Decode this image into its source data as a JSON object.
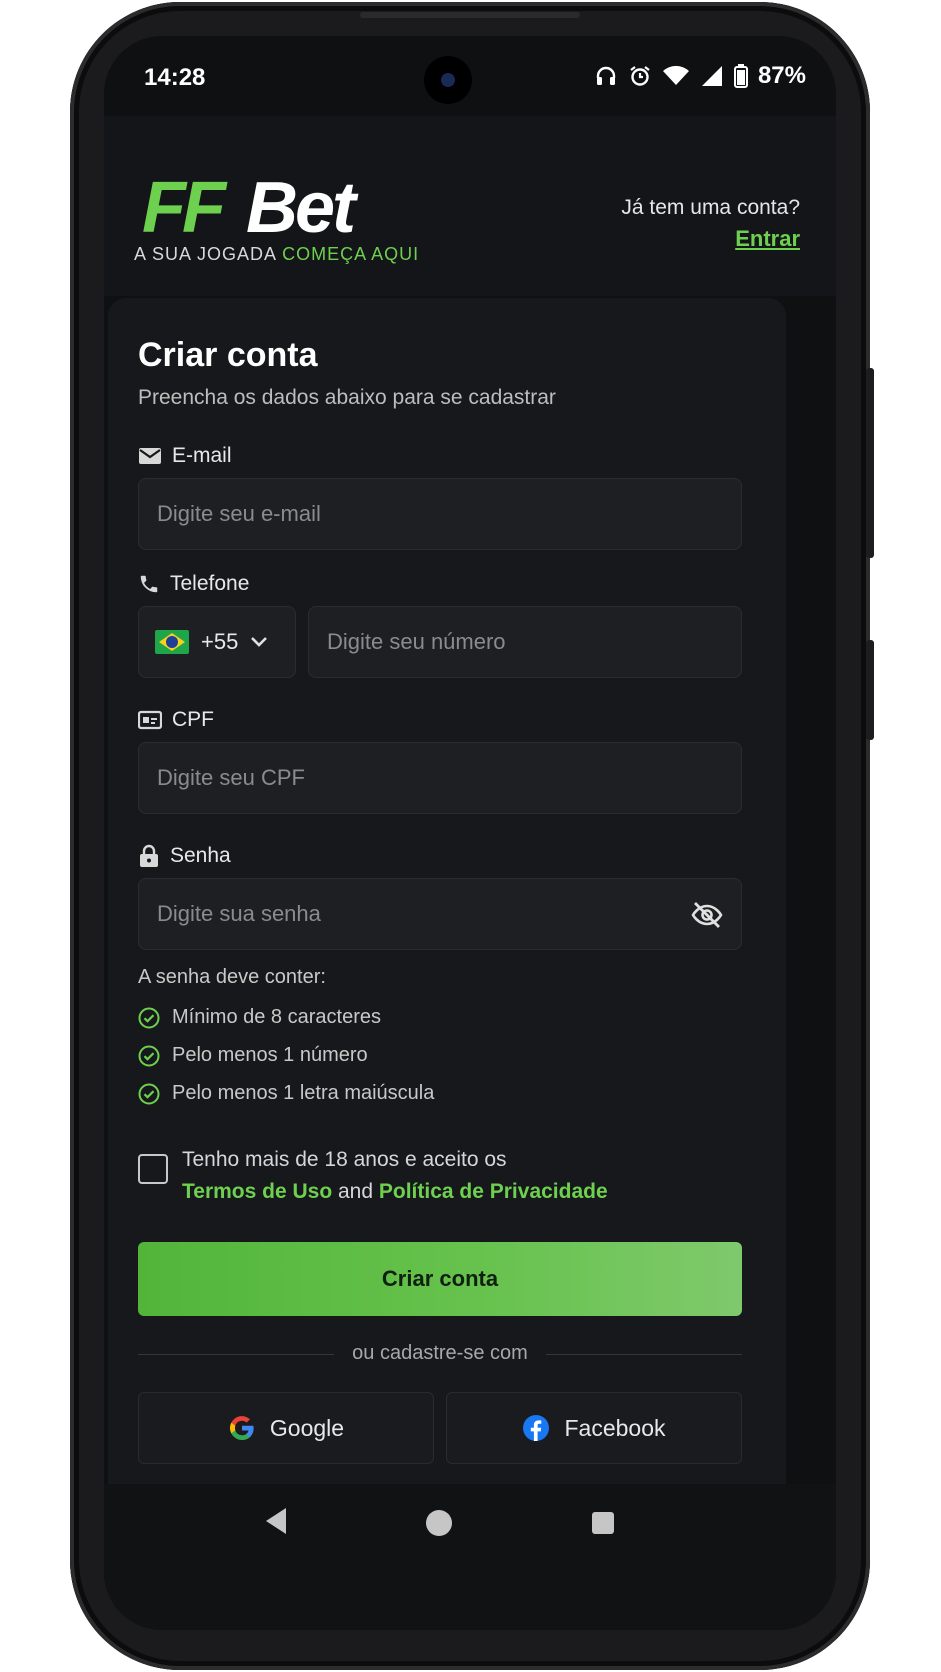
{
  "status": {
    "time": "14:28",
    "battery": "87%",
    "icons": [
      "headphones-icon",
      "alarm-icon",
      "wifi-icon",
      "signal-icon",
      "battery-icon"
    ]
  },
  "header": {
    "logo_ff": "FF",
    "logo_bet": "Bet",
    "tagline_prefix": "A SUA JOGADA",
    "tagline_highlight": "COMEÇA AQUI",
    "account_question": "Já tem uma conta?",
    "login_link": "Entrar"
  },
  "form": {
    "title": "Criar conta",
    "subtitle": "Preencha os dados abaixo para se cadastrar",
    "email": {
      "label": "E-mail",
      "placeholder": "Digite seu e-mail"
    },
    "phone": {
      "label": "Telefone",
      "country_code": "+55",
      "placeholder": "Digite seu número"
    },
    "cpf": {
      "label": "CPF",
      "placeholder": "Digite seu CPF"
    },
    "password": {
      "label": "Senha",
      "placeholder": "Digite sua senha"
    },
    "password_rules_title": "A senha deve conter:",
    "password_rules": [
      "Mínimo de 8 caracteres",
      "Pelo menos 1 número",
      "Pelo menos 1 letra maiúscula"
    ],
    "terms_line1": "Tenho mais de 18 anos e aceito os",
    "terms_link1": "Termos de Uso",
    "terms_and": "and",
    "terms_link2": "Política de Privacidade",
    "submit_label": "Criar conta",
    "divider_text": "ou cadastre-se com",
    "google_label": "Google",
    "facebook_label": "Facebook"
  },
  "colors": {
    "accent": "#6ed04f",
    "background": "#0f1012",
    "card": "#17181b"
  }
}
